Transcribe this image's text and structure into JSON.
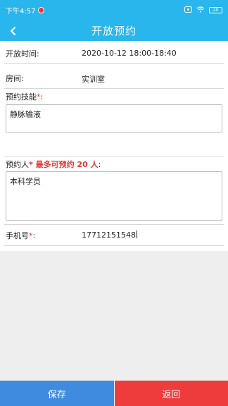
{
  "status_bar": {
    "time": "下午4:57",
    "battery": "20"
  },
  "header": {
    "title": "开放预约"
  },
  "form": {
    "open_time": {
      "label": "开放时间:",
      "value": "2020-10-12 18:00-18:40"
    },
    "room": {
      "label": "房间:",
      "value": "实训室"
    },
    "skill": {
      "label": "预约技能",
      "required_mark": "*",
      "colon": ":",
      "value": "静脉输液"
    },
    "booker": {
      "label": "预约人",
      "hint": "* 最多可预约 20 人",
      "colon": ":",
      "value": "本科学员"
    },
    "phone": {
      "label": "手机号",
      "required_mark": "*",
      "colon": ":",
      "value": "17712151548"
    }
  },
  "footer": {
    "save_label": "保存",
    "back_label": "返回"
  }
}
